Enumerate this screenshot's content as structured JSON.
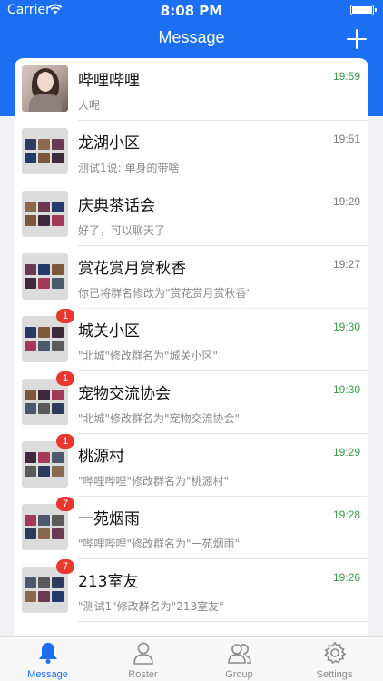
{
  "status": {
    "carrier": "Carrier",
    "time": "8:08 PM"
  },
  "nav": {
    "title": "Message"
  },
  "conversations": [
    {
      "name": "哔哩哔哩",
      "message": "人呢",
      "time": "19:59",
      "unread": "",
      "avatar": "person",
      "time_color": "#3a9a4a"
    },
    {
      "name": "龙湖小区",
      "message": "测试1说: 单身的带啥",
      "time": "19:51",
      "unread": "",
      "avatar": "group",
      "time_color": "#7a7a7a"
    },
    {
      "name": "庆典茶话会",
      "message": "好了，可以聊天了",
      "time": "19:29",
      "unread": "",
      "avatar": "group",
      "time_color": "#7a7a7a"
    },
    {
      "name": "赏花赏月赏秋香",
      "message": "你已将群名修改为\"赏花赏月赏秋香\"",
      "time": "19:27",
      "unread": "",
      "avatar": "group",
      "time_color": "#7a7a7a"
    },
    {
      "name": "城关小区",
      "message": "\"北城\"修改群名为\"城关小区\"",
      "time": "19:30",
      "unread": "1",
      "avatar": "group",
      "time_color": "#3a9a4a"
    },
    {
      "name": "宠物交流协会",
      "message": "\"北城\"修改群名为\"宠物交流协会\"",
      "time": "19:30",
      "unread": "1",
      "avatar": "group",
      "time_color": "#3a9a4a"
    },
    {
      "name": "桃源村",
      "message": "\"哔哩哔哩\"修改群名为\"桃源村\"",
      "time": "19:29",
      "unread": "1",
      "avatar": "group",
      "time_color": "#3a9a4a"
    },
    {
      "name": "一苑烟雨",
      "message": "\"哔哩哔哩\"修改群名为\"一苑烟雨\"",
      "time": "19:28",
      "unread": "7",
      "avatar": "group",
      "time_color": "#3a9a4a"
    },
    {
      "name": "213室友",
      "message": "\"测试1\"修改群名为\"213室友\"",
      "time": "19:26",
      "unread": "7",
      "avatar": "group",
      "time_color": "#3a9a4a"
    }
  ],
  "tabs": [
    {
      "label": "Message",
      "icon": "bell-icon",
      "active": true
    },
    {
      "label": "Roster",
      "icon": "person-icon",
      "active": false
    },
    {
      "label": "Group",
      "icon": "group-icon",
      "active": false
    },
    {
      "label": "Settings",
      "icon": "gear-icon",
      "active": false
    }
  ],
  "colors": {
    "accent": "#1b6ff0",
    "badge": "#e8372f"
  }
}
